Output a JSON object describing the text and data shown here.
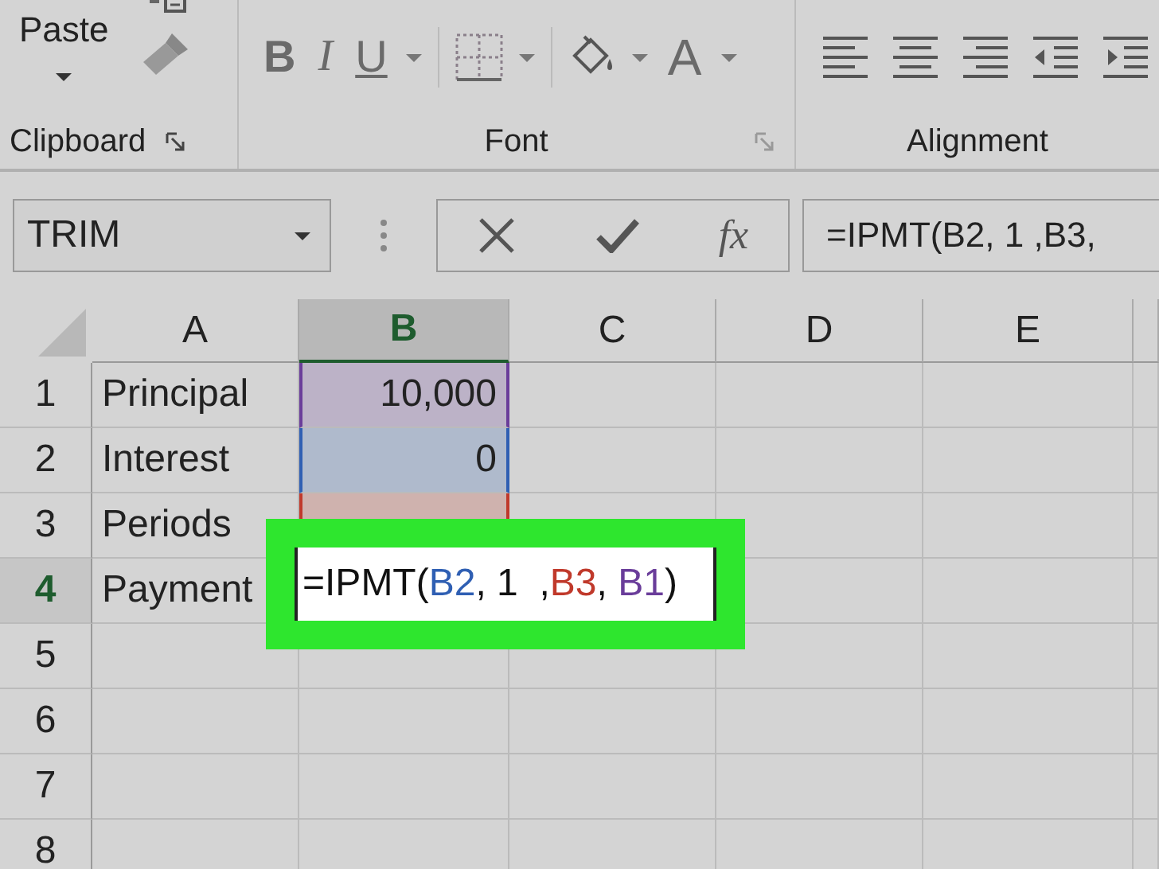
{
  "ribbon": {
    "groups": [
      {
        "kind": "clipboard",
        "label": "Clipboard",
        "paste": "Paste"
      },
      {
        "kind": "font",
        "label": "Font",
        "bold": "B",
        "italic": "I",
        "underline": "U",
        "font_color": "A"
      },
      {
        "kind": "alignment",
        "label": "Alignment"
      }
    ]
  },
  "formula_bar": {
    "name_box": "TRIM",
    "fx": "fx",
    "formula": "=IPMT(B2, 1  ,B3,"
  },
  "columns": [
    {
      "label": "A",
      "selected": false
    },
    {
      "label": "B",
      "selected": true
    },
    {
      "label": "C",
      "selected": false
    },
    {
      "label": "D",
      "selected": false
    },
    {
      "label": "E",
      "selected": false
    }
  ],
  "rows": [
    {
      "number": "1",
      "selected": false,
      "label": "Principal",
      "value": "10,000",
      "color": "#6a3d9a"
    },
    {
      "number": "2",
      "selected": false,
      "label": "Interest",
      "value": "0",
      "color": "#2f5fb3"
    },
    {
      "number": "3",
      "selected": false,
      "label": "Periods",
      "color": "#c0392b"
    },
    {
      "number": "4",
      "selected": true,
      "label": "Payment"
    },
    {
      "number": "5",
      "selected": false
    },
    {
      "number": "6",
      "selected": false
    },
    {
      "number": "7",
      "selected": false
    },
    {
      "number": "8",
      "selected": false
    }
  ],
  "editing_cell": {
    "tokens": [
      {
        "text": "=IPMT(",
        "color": "#111111"
      },
      {
        "text": "B2",
        "color": "#2f5fb3"
      },
      {
        "text": ", 1  ,",
        "color": "#111111"
      },
      {
        "text": "B3",
        "color": "#c0392b"
      },
      {
        "text": ", ",
        "color": "#111111"
      },
      {
        "text": "B1",
        "color": "#6a3d9a"
      },
      {
        "text": ")",
        "color": "#111111"
      }
    ]
  }
}
